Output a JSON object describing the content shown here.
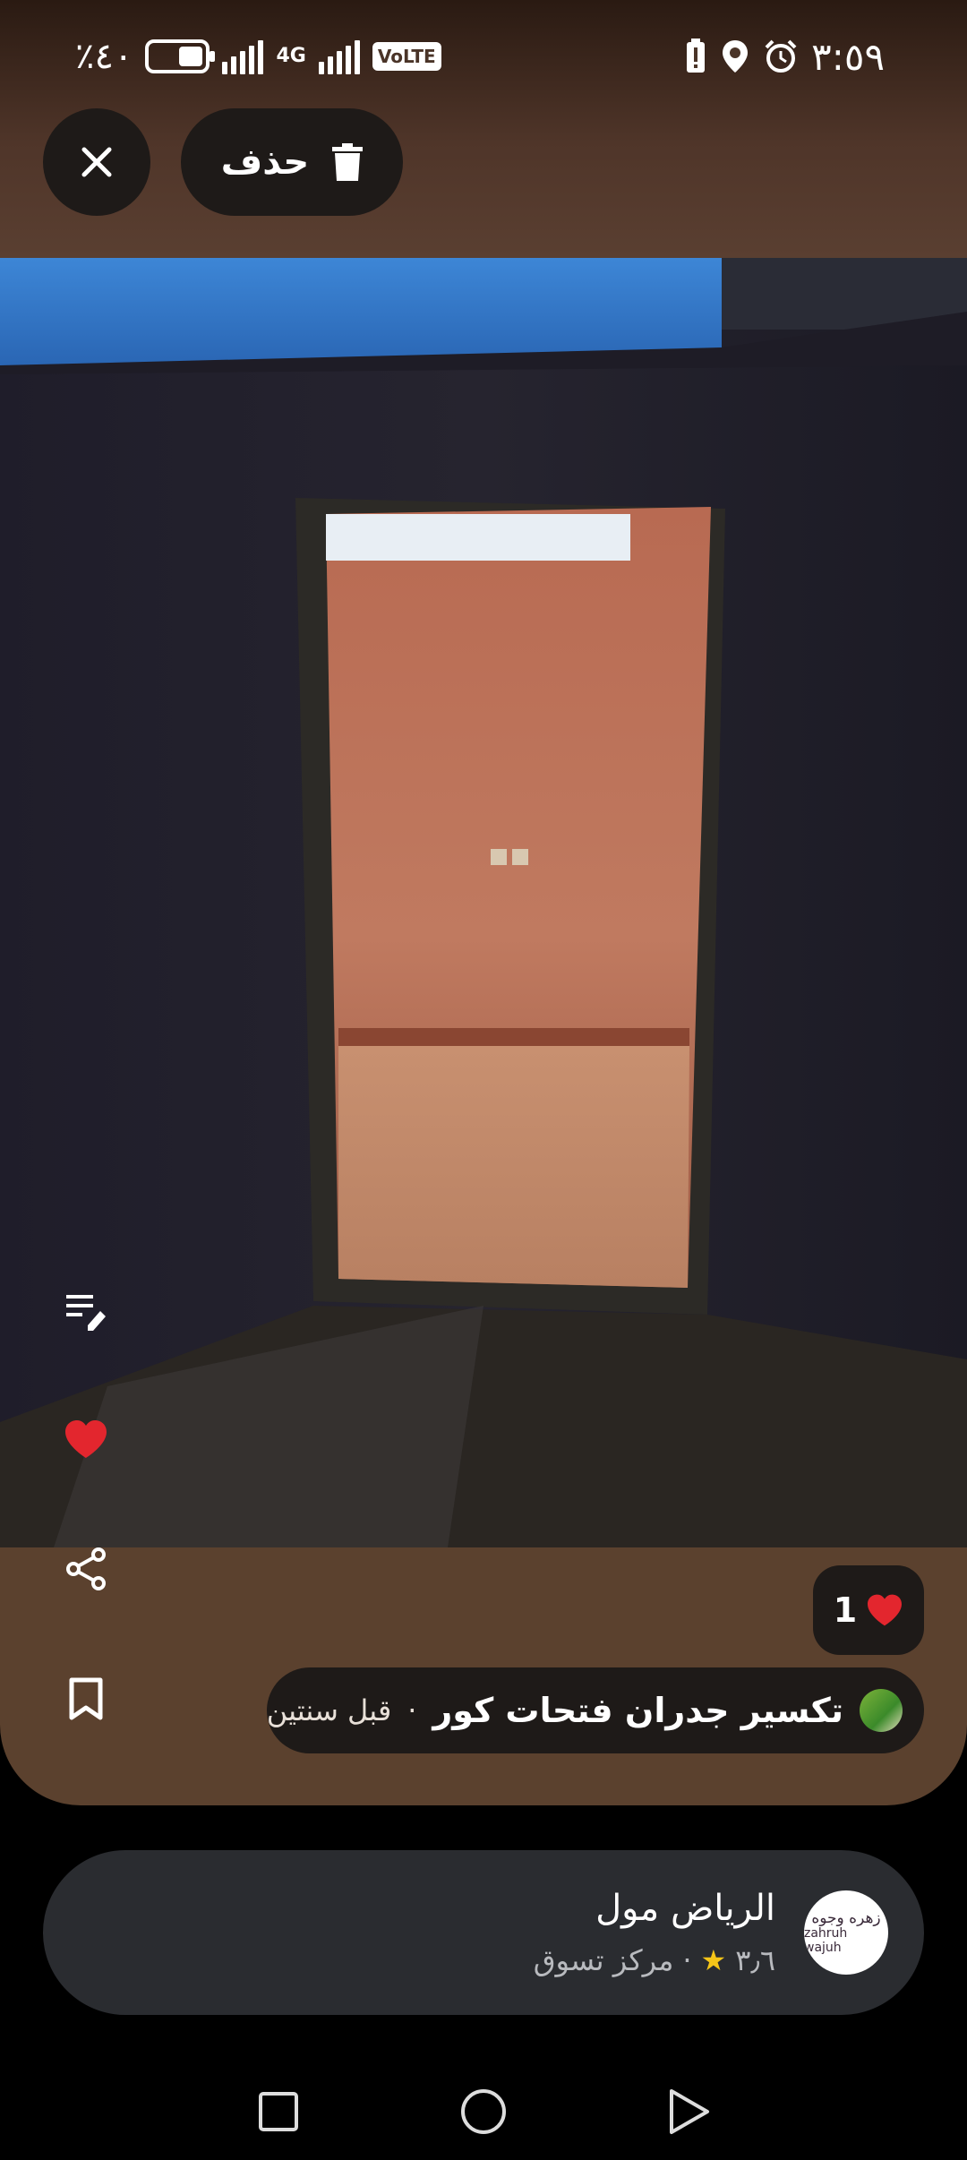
{
  "status_bar": {
    "battery_text": "٪٤٠",
    "battery_level": 0.4,
    "network": "4G",
    "volte": "VoLTE",
    "time": "٣:٥٩"
  },
  "top_actions": {
    "delete_label": "حذف"
  },
  "photo": {
    "description_icon": "photo"
  },
  "side_actions": {
    "icons": [
      "edit-note-icon",
      "heart-icon",
      "share-icon",
      "bookmark-icon"
    ]
  },
  "likes": {
    "count": "1"
  },
  "post": {
    "title": "تكسير جدران فتحات كور",
    "separator": "·",
    "time": "قبل سنتين"
  },
  "place": {
    "name": "الرياض مول",
    "rating": "٣٫٦",
    "separator": "·",
    "category": "مركز تسوق",
    "logo_text_ar": "زهره وجوه",
    "logo_text_en": "zahruh wajuh"
  },
  "colors": {
    "card_bg": "#5b412e",
    "chip_bg": "#1e1a18",
    "place_card_bg": "#2a2c30",
    "heart": "#e3262e",
    "star": "#f5c518"
  }
}
